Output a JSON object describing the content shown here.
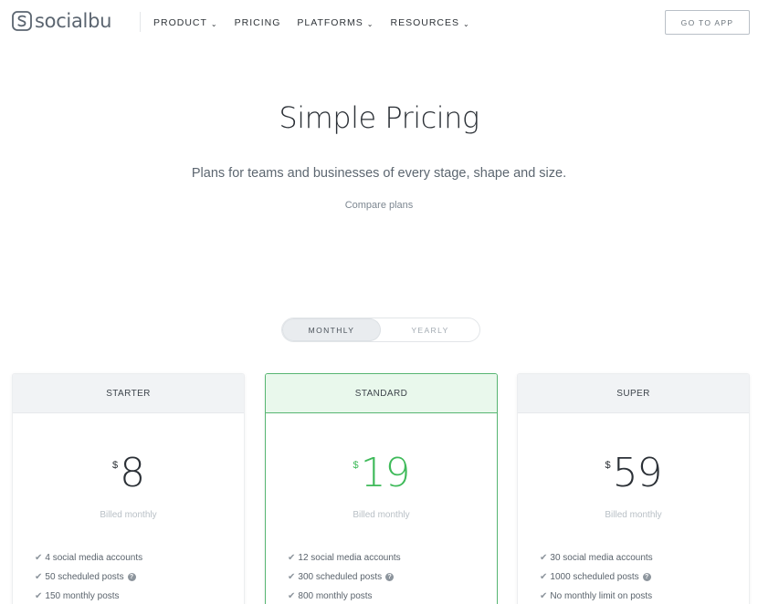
{
  "brand": {
    "name": "socialbu"
  },
  "nav": {
    "links": [
      {
        "label": "PRODUCT",
        "dropdown": true
      },
      {
        "label": "PRICING",
        "dropdown": false
      },
      {
        "label": "PLATFORMS",
        "dropdown": true
      },
      {
        "label": "RESOURCES",
        "dropdown": true
      }
    ],
    "cta": "GO TO APP",
    "chevron": "⌄"
  },
  "hero": {
    "title": "Simple Pricing",
    "subtitle": "Plans for teams and businesses of every stage, shape and size.",
    "compare_link": "Compare plans"
  },
  "billing_toggle": {
    "options": [
      "MONTHLY",
      "YEARLY"
    ],
    "selected": "MONTHLY"
  },
  "plans": [
    {
      "name": "STARTER",
      "currency": "$",
      "price": "8",
      "billing": "Billed monthly",
      "featured": false,
      "features": [
        {
          "text": "4 social media accounts",
          "info": false
        },
        {
          "text": "50 scheduled posts",
          "info": true
        },
        {
          "text": "150 monthly posts",
          "info": false
        }
      ]
    },
    {
      "name": "STANDARD",
      "currency": "$",
      "price": "19",
      "billing": "Billed monthly",
      "featured": true,
      "features": [
        {
          "text": "12 social media accounts",
          "info": false
        },
        {
          "text": "300 scheduled posts",
          "info": true
        },
        {
          "text": "800 monthly posts",
          "info": false
        }
      ]
    },
    {
      "name": "SUPER",
      "currency": "$",
      "price": "59",
      "billing": "Billed monthly",
      "featured": false,
      "features": [
        {
          "text": "30 social media accounts",
          "info": false
        },
        {
          "text": "1000 scheduled posts",
          "info": true
        },
        {
          "text": "No monthly limit on posts",
          "info": false
        }
      ]
    }
  ],
  "icons": {
    "check": "check-icon",
    "info": "question-circle-icon",
    "logo": "socialbu-logo-icon"
  },
  "colors": {
    "accent_green": "#3fba5a",
    "featured_border": "#57b672",
    "featured_head_bg": "#e9f8ec"
  }
}
